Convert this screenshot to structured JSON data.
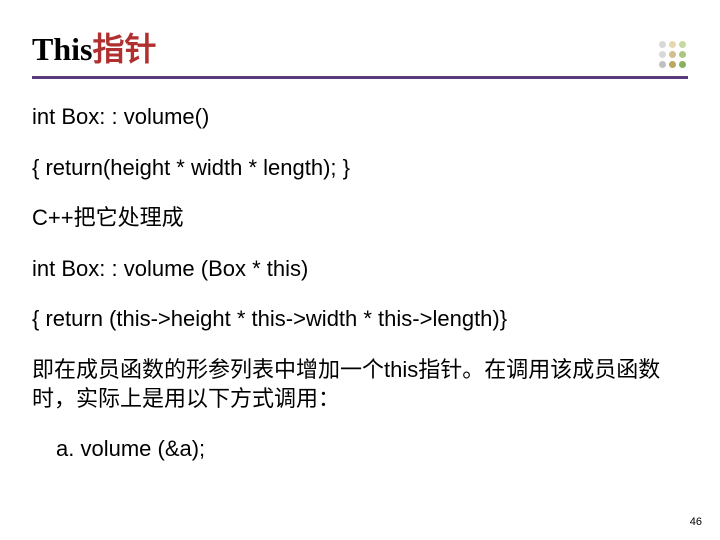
{
  "title": {
    "this": "This",
    "cn": "指针"
  },
  "content": {
    "l1": "int Box: : volume()",
    "l2": "{ return(height * width * length); }",
    "l3": "C++把它处理成",
    "l4": "int Box: : volume (Box * this)",
    "l5": "{ return (this->height *  this->width * this->length)}",
    "l6": "即在成员函数的形参列表中增加一个this指针。在调用该成员函数时，实际上是用以下方式调用：",
    "l7": " a. volume (&a);"
  },
  "colors": {
    "r1c1": "#d8d8d8",
    "r1c2": "#e8d8b0",
    "r1c3": "#c8d8a0",
    "r2c1": "#d8d8d8",
    "r2c2": "#d0c090",
    "r2c3": "#a8c880",
    "r3c1": "#c0c0c0",
    "r3c2": "#b8a860",
    "r3c3": "#88b060"
  },
  "pageNumber": "46"
}
